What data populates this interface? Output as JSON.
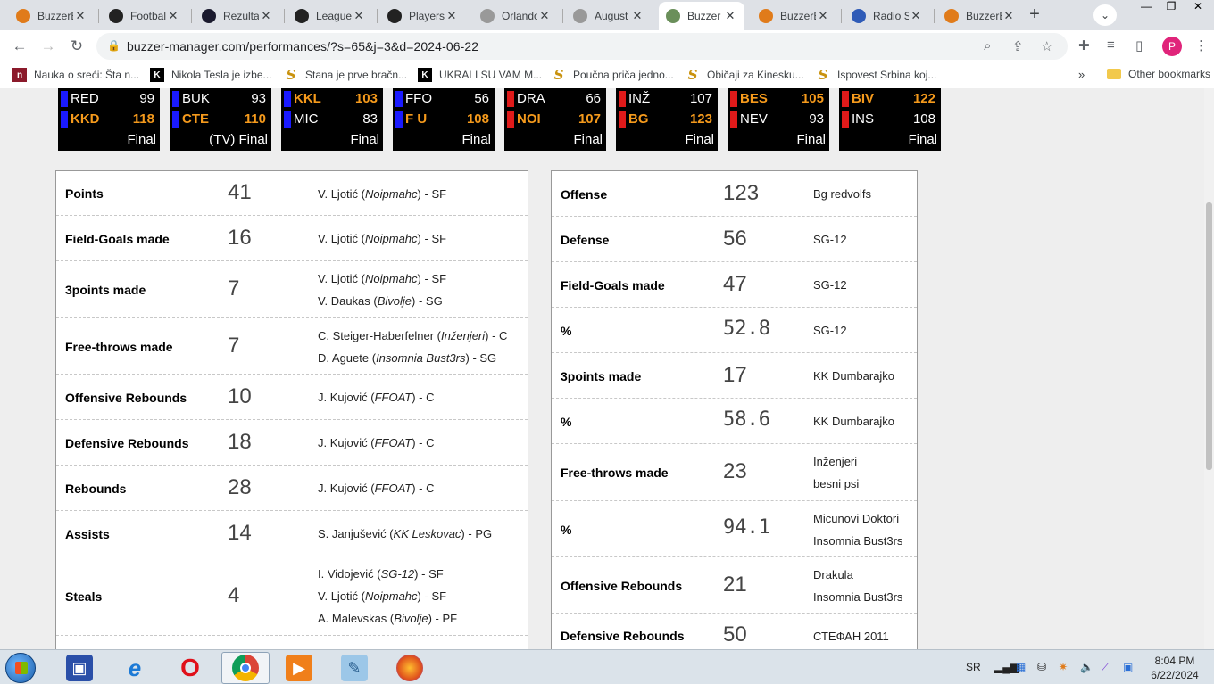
{
  "browser": {
    "tabs": [
      {
        "title": "BuzzerB",
        "fav": "#e07b1a"
      },
      {
        "title": "Footbal",
        "fav": "#222"
      },
      {
        "title": "Rezultat",
        "fav": "#1a1a2e"
      },
      {
        "title": "League",
        "fav": "#222"
      },
      {
        "title": "Players",
        "fav": "#222"
      },
      {
        "title": "Orlando",
        "fav": "#999"
      },
      {
        "title": "August",
        "fav": "#999"
      },
      {
        "title": "Buzzer",
        "fav": "#6a8f5a"
      },
      {
        "title": "BuzzerB",
        "fav": "#e07b1a"
      },
      {
        "title": "Radio S",
        "fav": "#2f5bb7"
      },
      {
        "title": "BuzzerB",
        "fav": "#e07b1a"
      }
    ],
    "url": "buzzer-manager.com/performances/?s=65&j=3&d=2024-06-22",
    "profile_initial": "P",
    "bookmarks": [
      {
        "label": "Nauka o sreći: Šta n...",
        "icon": "n"
      },
      {
        "label": "Nikola Tesla je izbe...",
        "icon": "k"
      },
      {
        "label": "Stana je prve bračn...",
        "icon": "s"
      },
      {
        "label": "UKRALI SU VAM M...",
        "icon": "k"
      },
      {
        "label": "Poučna priča jedno...",
        "icon": "s"
      },
      {
        "label": "Običaji za Kinesku...",
        "icon": "s"
      },
      {
        "label": "Ispovest Srbina koj...",
        "icon": "s"
      }
    ],
    "bookmarks_more": "»",
    "other_bookmarks": "Other bookmarks"
  },
  "scores": [
    {
      "t1": "RED",
      "p1": "99",
      "t2": "KKD",
      "p2": "118",
      "w": 2,
      "status": "Final",
      "c1": "#1a1aff",
      "c2": "#1a1aff"
    },
    {
      "t1": "BUK",
      "p1": "93",
      "t2": "CTE",
      "p2": "110",
      "w": 2,
      "status": "(TV) Final",
      "c1": "#1a1aff",
      "c2": "#1a1aff"
    },
    {
      "t1": "KKL",
      "p1": "103",
      "t2": "MIC",
      "p2": "83",
      "w": 1,
      "status": "Final",
      "c1": "#1a1aff",
      "c2": "#1a1aff"
    },
    {
      "t1": "FFO",
      "p1": "56",
      "t2": "F U",
      "p2": "108",
      "w": 2,
      "status": "Final",
      "c1": "#1a1aff",
      "c2": "#1a1aff"
    },
    {
      "t1": "DRA",
      "p1": "66",
      "t2": "NOI",
      "p2": "107",
      "w": 2,
      "status": "Final",
      "c1": "#e01a1a",
      "c2": "#e01a1a"
    },
    {
      "t1": "INŽ",
      "p1": "107",
      "t2": "BG",
      "p2": "123",
      "w": 2,
      "status": "Final",
      "c1": "#e01a1a",
      "c2": "#e01a1a"
    },
    {
      "t1": "BES",
      "p1": "105",
      "t2": "NEV",
      "p2": "93",
      "w": 1,
      "status": "Final",
      "c1": "#e01a1a",
      "c2": "#e01a1a"
    },
    {
      "t1": "BIV",
      "p1": "122",
      "t2": "INS",
      "p2": "108",
      "w": 1,
      "status": "Final",
      "c1": "#e01a1a",
      "c2": "#e01a1a"
    }
  ],
  "player_stats": [
    {
      "cat": "Points",
      "val": "41",
      "players": [
        {
          "name": "V. Ljotić",
          "team": "Noipmahc",
          "pos": "SF"
        }
      ]
    },
    {
      "cat": "Field-Goals made",
      "val": "16",
      "players": [
        {
          "name": "V. Ljotić",
          "team": "Noipmahc",
          "pos": "SF"
        }
      ]
    },
    {
      "cat": "3points made",
      "val": "7",
      "players": [
        {
          "name": "V. Ljotić",
          "team": "Noipmahc",
          "pos": "SF"
        },
        {
          "name": "V. Daukas",
          "team": "Bivolje",
          "pos": "SG"
        }
      ]
    },
    {
      "cat": "Free-throws made",
      "val": "7",
      "players": [
        {
          "name": "C. Steiger-Haberfelner",
          "team": "Inženjeri",
          "pos": "C"
        },
        {
          "name": "D. Aguete",
          "team": "Insomnia Bust3rs",
          "pos": "SG"
        }
      ]
    },
    {
      "cat": "Offensive Rebounds",
      "val": "10",
      "players": [
        {
          "name": "J. Kujović",
          "team": "FFOAT",
          "pos": "C"
        }
      ]
    },
    {
      "cat": "Defensive Rebounds",
      "val": "18",
      "players": [
        {
          "name": "J. Kujović",
          "team": "FFOAT",
          "pos": "C"
        }
      ]
    },
    {
      "cat": "Rebounds",
      "val": "28",
      "players": [
        {
          "name": "J. Kujović",
          "team": "FFOAT",
          "pos": "C"
        }
      ]
    },
    {
      "cat": "Assists",
      "val": "14",
      "players": [
        {
          "name": "S. Janjušević",
          "team": "KK Leskovac",
          "pos": "PG"
        }
      ]
    },
    {
      "cat": "Steals",
      "val": "4",
      "players": [
        {
          "name": "I. Vidojević",
          "team": "SG-12",
          "pos": "SF"
        },
        {
          "name": "V. Ljotić",
          "team": "Noipmahc",
          "pos": "SF"
        },
        {
          "name": "A. Malevskas",
          "team": "Bivolje",
          "pos": "PF"
        }
      ]
    }
  ],
  "team_stats": [
    {
      "cat": "Offense",
      "val": "123",
      "teams": [
        "Bg redvolfs"
      ]
    },
    {
      "cat": "Defense",
      "val": "56",
      "teams": [
        "SG-12"
      ]
    },
    {
      "cat": "Field-Goals made",
      "val": "47",
      "teams": [
        "SG-12"
      ]
    },
    {
      "cat": "%",
      "val": "52.8",
      "teams": [
        "SG-12"
      ],
      "mono": true
    },
    {
      "cat": "3points made",
      "val": "17",
      "teams": [
        "KK Dumbarajko"
      ]
    },
    {
      "cat": "%",
      "val": "58.6",
      "teams": [
        "KK Dumbarajko"
      ],
      "mono": true
    },
    {
      "cat": "Free-throws made",
      "val": "23",
      "teams": [
        "Inženjeri",
        "besni psi"
      ]
    },
    {
      "cat": "%",
      "val": "94.1",
      "teams": [
        "Micunovi Doktori",
        "Insomnia Bust3rs"
      ],
      "mono": true
    },
    {
      "cat": "Offensive Rebounds",
      "val": "21",
      "teams": [
        "Drakula",
        "Insomnia Bust3rs"
      ]
    },
    {
      "cat": "Defensive Rebounds",
      "val": "50",
      "teams": [
        "СТЕФАН 2011"
      ]
    }
  ],
  "taskbar": {
    "lang": "SR",
    "time": "8:04 PM",
    "date": "6/22/2024"
  }
}
